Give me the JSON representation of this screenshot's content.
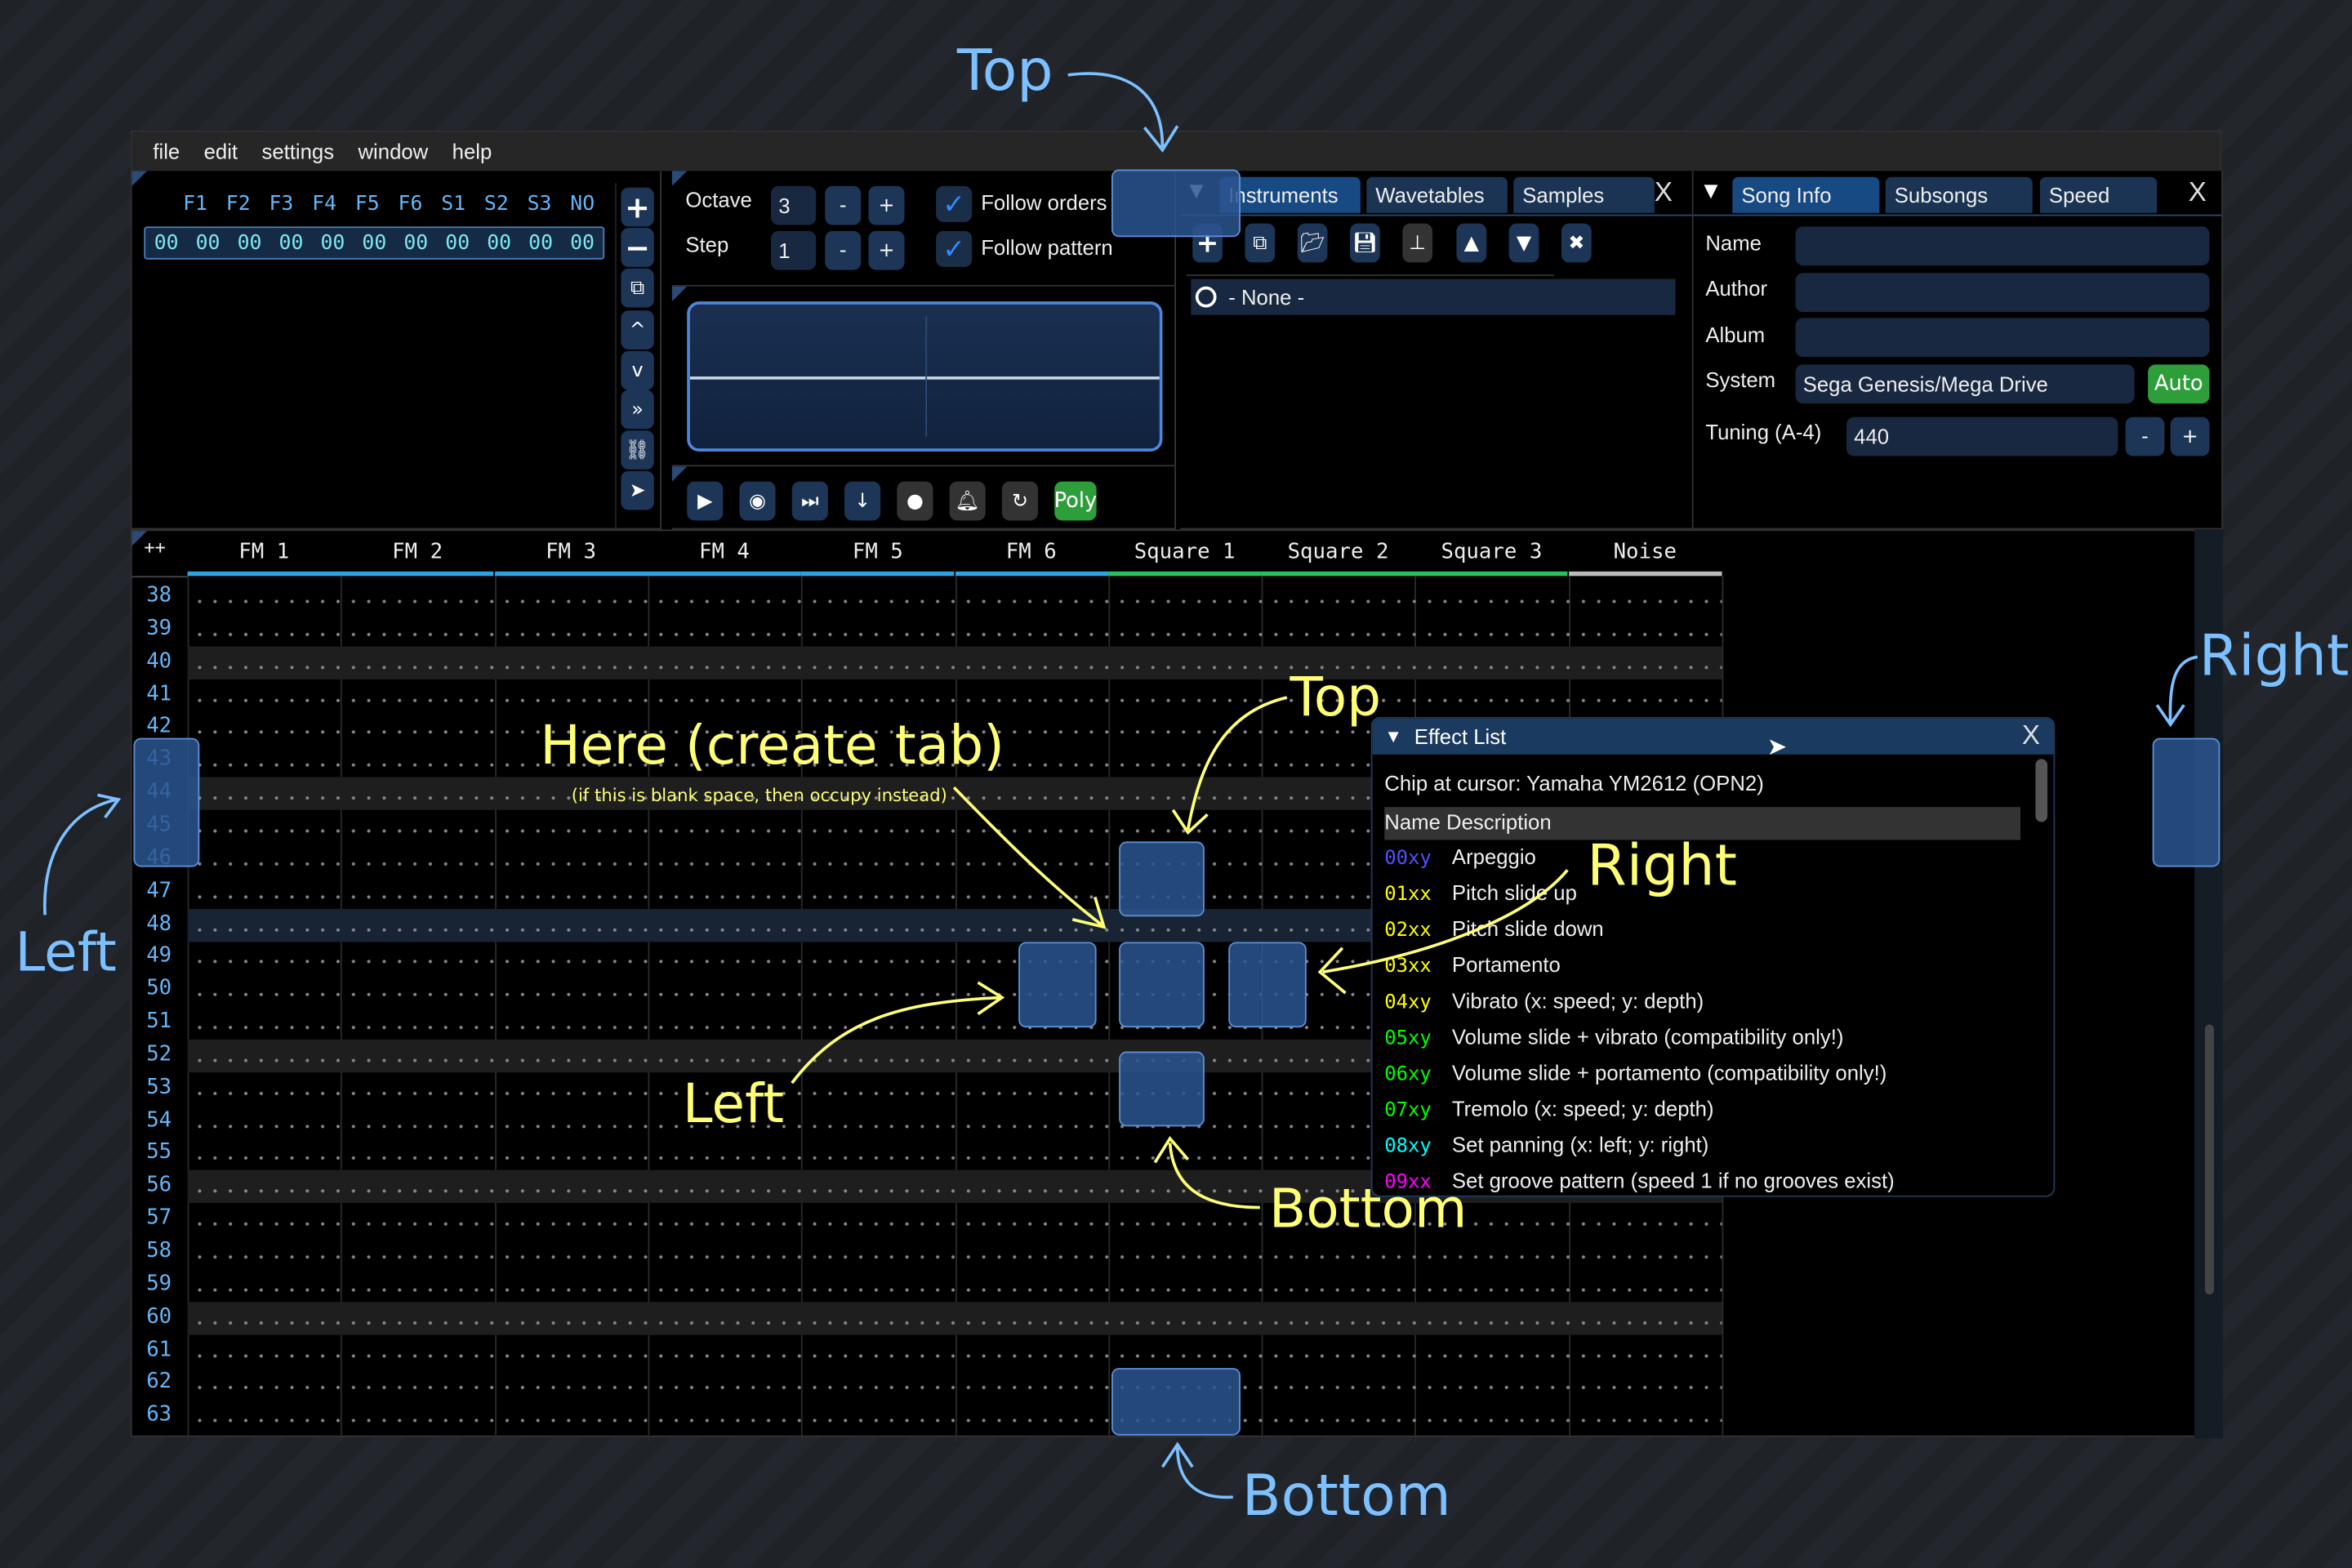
{
  "menu": [
    "file",
    "edit",
    "settings",
    "window",
    "help"
  ],
  "orders": {
    "channels": [
      "F1",
      "F2",
      "F3",
      "F4",
      "F5",
      "F6",
      "S1",
      "S2",
      "S3",
      "NO"
    ],
    "row": [
      "00",
      "00",
      "00",
      "00",
      "00",
      "00",
      "00",
      "00",
      "00",
      "00",
      "00"
    ]
  },
  "controls": {
    "octave_label": "Octave",
    "octave_value": "3",
    "step_label": "Step",
    "step_value": "1",
    "minus": "-",
    "plus": "+",
    "follow_orders": "Follow orders",
    "follow_pattern": "Follow pattern",
    "poly": "Poly"
  },
  "instruments": {
    "tabs": [
      "Instruments",
      "Wavetables",
      "Samples"
    ],
    "close": "X",
    "items": [
      "- None -"
    ]
  },
  "song_info": {
    "tabs": [
      "Song Info",
      "Subsongs",
      "Speed"
    ],
    "close": "X",
    "name_label": "Name",
    "name_value": "",
    "author_label": "Author",
    "author_value": "",
    "album_label": "Album",
    "album_value": "",
    "system_label": "System",
    "system_value": "Sega Genesis/Mega Drive",
    "auto": "Auto",
    "tuning_label": "Tuning (A-4)",
    "tuning_value": "440",
    "minus": "-",
    "plus": "+"
  },
  "pattern": {
    "corner": "++",
    "channels": [
      "FM 1",
      "FM 2",
      "FM 3",
      "FM 4",
      "FM 5",
      "FM 6",
      "Square 1",
      "Square 2",
      "Square 3",
      "Noise"
    ],
    "rows": [
      "38",
      "39",
      "40",
      "41",
      "42",
      "43",
      "44",
      "45",
      "46",
      "47",
      "48",
      "49",
      "50",
      "51",
      "52",
      "53",
      "54",
      "55",
      "56",
      "57",
      "58",
      "59",
      "60",
      "61",
      "62",
      "63"
    ]
  },
  "effect_list": {
    "title": "Effect List",
    "close": "X",
    "chip": "Chip at cursor: Yamaha YM2612 (OPN2)",
    "header": "Name Description",
    "effects": [
      {
        "code": "00xy",
        "desc": "Arpeggio",
        "color": "#5050ff"
      },
      {
        "code": "01xx",
        "desc": "Pitch slide up",
        "color": "#ffff00"
      },
      {
        "code": "02xx",
        "desc": "Pitch slide down",
        "color": "#ffff00"
      },
      {
        "code": "03xx",
        "desc": "Portamento",
        "color": "#ffff00"
      },
      {
        "code": "04xy",
        "desc": "Vibrato (x: speed; y: depth)",
        "color": "#ffff00"
      },
      {
        "code": "05xy",
        "desc": "Volume slide + vibrato (compatibility only!)",
        "color": "#00ff00"
      },
      {
        "code": "06xy",
        "desc": "Volume slide + portamento (compatibility only!)",
        "color": "#00ff00"
      },
      {
        "code": "07xy",
        "desc": "Tremolo (x: speed; y: depth)",
        "color": "#00ff00"
      },
      {
        "code": "08xy",
        "desc": "Set panning (x: left; y: right)",
        "color": "#00ffff"
      },
      {
        "code": "09xx",
        "desc": "Set groove pattern (speed 1 if no grooves exist)",
        "color": "#ff00ff"
      }
    ]
  },
  "annotations": {
    "inner": {
      "here": "Here (create tab)",
      "here_sub": "(if this is blank space, then occupy instead)",
      "top": "Top",
      "left": "Left",
      "right": "Right",
      "bottom": "Bottom"
    },
    "outer": {
      "top": "Top",
      "left": "Left",
      "right": "Right",
      "bottom": "Bottom"
    }
  },
  "colors": {
    "accent": "#2ea3dd",
    "fm_underline": "#2ea3dd",
    "square_underline": "#2bbf5e",
    "annotation_inner": "#ffff77",
    "annotation_outer": "#7cc0ff",
    "poly": "#2e9e3a"
  }
}
